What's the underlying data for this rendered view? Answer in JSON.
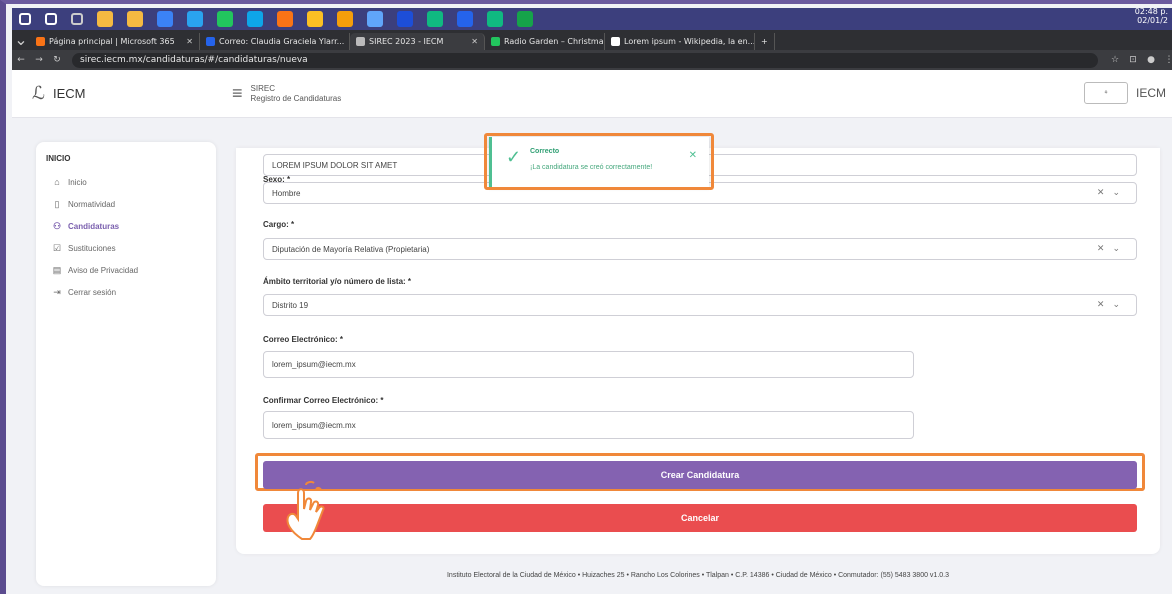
{
  "taskbar": {
    "icons": [
      {
        "name": "windows-start-icon",
        "color": "#ffffff"
      },
      {
        "name": "search-icon",
        "color": "#ffffff"
      },
      {
        "name": "task-view-icon",
        "color": "#cccccc"
      },
      {
        "name": "app-icon",
        "color": "#f5b942"
      },
      {
        "name": "app-icon",
        "color": "#f5b942"
      },
      {
        "name": "app-icon",
        "color": "#3b82f6"
      },
      {
        "name": "app-icon",
        "color": "#2aa3ef"
      },
      {
        "name": "app-icon",
        "color": "#22c55e"
      },
      {
        "name": "app-icon",
        "color": "#0ea5e9"
      },
      {
        "name": "app-icon",
        "color": "#f97316"
      },
      {
        "name": "chrome-icon",
        "color": "#fbbf24"
      },
      {
        "name": "app-icon",
        "color": "#f59e0b"
      },
      {
        "name": "app-icon",
        "color": "#60a5fa"
      },
      {
        "name": "app-icon",
        "color": "#1d4ed8"
      },
      {
        "name": "app-icon",
        "color": "#10b981"
      },
      {
        "name": "word-icon",
        "color": "#2563eb"
      },
      {
        "name": "app-icon",
        "color": "#10b981"
      },
      {
        "name": "excel-icon",
        "color": "#16a34a"
      }
    ],
    "clock_time": "02:48 p.",
    "clock_date": "02/01/2"
  },
  "tabs": [
    {
      "label": "Página principal | Microsoft 365",
      "fav": "#f97316"
    },
    {
      "label": "Correo: Claudia Graciela Ylarr...",
      "fav": "#2563eb"
    },
    {
      "label": "SIREC 2023 - IECM",
      "fav": "#bbbbbb",
      "active": true
    },
    {
      "label": "Radio Garden – Christmas",
      "fav": "#22c55e"
    },
    {
      "label": "Lorem ipsum - Wikipedia, la en...",
      "fav": "#ffffff"
    }
  ],
  "address": {
    "url": "sirec.iecm.mx/candidaturas/#/candidaturas/nueva"
  },
  "header": {
    "brand": "IECM",
    "sys_title": "SIREC",
    "sys_subtitle": "Registro de Candidaturas",
    "right_brand": "IECM"
  },
  "sidebar": {
    "heading": "INICIO",
    "items": [
      {
        "label": "Inicio",
        "icon": "home-icon",
        "glyph": "⌂"
      },
      {
        "label": "Normatividad",
        "icon": "document-icon",
        "glyph": "▯"
      },
      {
        "label": "Candidaturas",
        "icon": "users-icon",
        "glyph": "⚇",
        "active": true
      },
      {
        "label": "Sustituciones",
        "icon": "checkbox-icon",
        "glyph": "☑"
      },
      {
        "label": "Aviso de Privacidad",
        "icon": "notice-icon",
        "glyph": "▤"
      },
      {
        "label": "Cerrar sesión",
        "icon": "logout-icon",
        "glyph": "⇥"
      }
    ]
  },
  "form": {
    "top_value": "LOREM IPSUM DOLOR SIT AMET",
    "sexo_label": "Sexo: *",
    "sexo_value": "Hombre",
    "cargo_label": "Cargo: *",
    "cargo_value": "Diputación de Mayoría Relativa (Propietaria)",
    "ambito_label": "Ámbito territorial y/o número de lista: *",
    "ambito_value": "Distrito 19",
    "correo_label": "Correo Electrónico: *",
    "correo_value": "lorem_ipsum@iecm.mx",
    "confirmar_label": "Confirmar Correo Electrónico: *",
    "confirmar_value": "lorem_ipsum@iecm.mx",
    "create_label": "Crear Candidatura",
    "cancel_label": "Cancelar"
  },
  "toast": {
    "title": "Correcto",
    "message": "¡La candidatura se creó correctamente!"
  },
  "footer": {
    "text": "Instituto Electoral de la Ciudad de México • Huizaches 25 • Rancho Los Colorines • Tlalpan • C.P. 14386 • Ciudad de México • Conmutador: (55) 5483 3800 v1.0.3"
  }
}
